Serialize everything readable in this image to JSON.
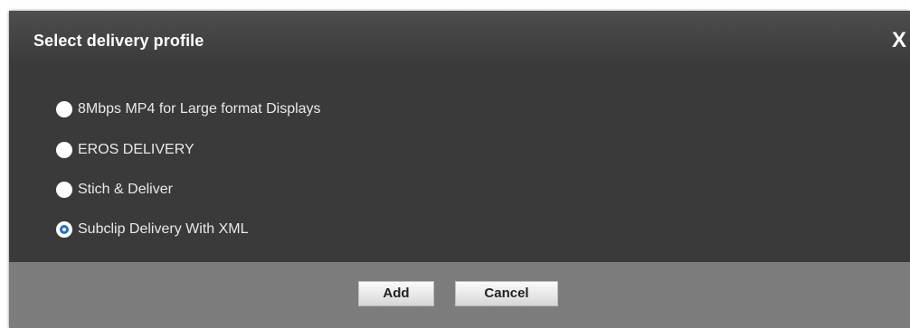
{
  "dialog": {
    "title": "Select delivery profile",
    "close_label": "X"
  },
  "options": [
    {
      "label": "8Mbps MP4 for Large format Displays",
      "selected": false
    },
    {
      "label": "EROS DELIVERY",
      "selected": false
    },
    {
      "label": "Stich & Deliver",
      "selected": false
    },
    {
      "label": "Subclip Delivery With XML",
      "selected": true
    }
  ],
  "buttons": {
    "add_label": "Add",
    "cancel_label": "Cancel"
  },
  "colors": {
    "title_bar": "#444444",
    "body": "#3a3a3a",
    "footer": "#7c7c7c",
    "radio_selected_ring": "#1e6fd0"
  }
}
